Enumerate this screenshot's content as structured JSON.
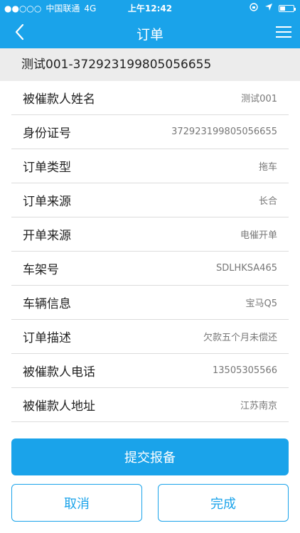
{
  "status_bar": {
    "signal": "●●○○○",
    "carrier": "中国联通",
    "network": "4G",
    "time": "上午12:42",
    "colors": {
      "background": "#1aa3ea"
    }
  },
  "nav": {
    "title": "订单",
    "back_icon": "chevron-left-icon",
    "menu_icon": "hamburger-menu-icon"
  },
  "order_header": "测试001-372923199805056655",
  "fields": [
    {
      "label": "被催款人姓名",
      "value": "测试001"
    },
    {
      "label": "身份证号",
      "value": "372923199805056655"
    },
    {
      "label": "订单类型",
      "value": "拖车"
    },
    {
      "label": "订单来源",
      "value": "长合"
    },
    {
      "label": "开单来源",
      "value": "电催开单"
    },
    {
      "label": "车架号",
      "value": "SDLHKSA465"
    },
    {
      "label": "车辆信息",
      "value": "宝马Q5"
    },
    {
      "label": "订单描述",
      "value": "欠款五个月未偿还"
    },
    {
      "label": "被催款人电话",
      "value": "13505305566"
    },
    {
      "label": "被催款人地址",
      "value": "江苏南京"
    }
  ],
  "actions": {
    "submit_label": "提交报备",
    "cancel_label": "取消",
    "done_label": "完成"
  },
  "colors": {
    "accent": "#1aa3ea",
    "header_bg": "#ececec",
    "divider": "#dcdcdc"
  }
}
